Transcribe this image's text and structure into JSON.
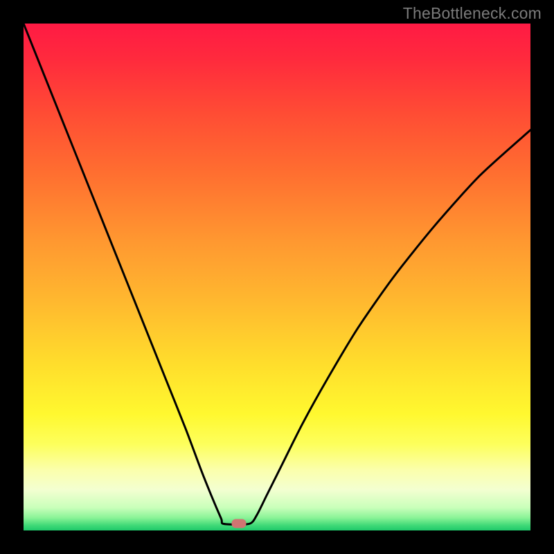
{
  "watermark": "TheBottleneck.com",
  "colors": {
    "frame": "#000000",
    "marker": "#cf7572",
    "curve": "#000000",
    "gradient_stops": [
      {
        "offset": 0.0,
        "color": "#ff1a44"
      },
      {
        "offset": 0.07,
        "color": "#ff2a3d"
      },
      {
        "offset": 0.18,
        "color": "#ff4d34"
      },
      {
        "offset": 0.3,
        "color": "#ff7030"
      },
      {
        "offset": 0.43,
        "color": "#ff9830"
      },
      {
        "offset": 0.55,
        "color": "#ffb92f"
      },
      {
        "offset": 0.67,
        "color": "#ffdd2c"
      },
      {
        "offset": 0.77,
        "color": "#fff82f"
      },
      {
        "offset": 0.83,
        "color": "#fdff5c"
      },
      {
        "offset": 0.88,
        "color": "#fbffab"
      },
      {
        "offset": 0.92,
        "color": "#f3ffd1"
      },
      {
        "offset": 0.955,
        "color": "#c9ffba"
      },
      {
        "offset": 0.975,
        "color": "#8af397"
      },
      {
        "offset": 0.99,
        "color": "#3fd977"
      },
      {
        "offset": 1.0,
        "color": "#1fc96a"
      }
    ]
  },
  "chart_data": {
    "type": "line",
    "title": "",
    "xlabel": "",
    "ylabel": "",
    "x_range": [
      0,
      100
    ],
    "y_range": [
      0,
      100
    ],
    "minimum_at_x": 42,
    "flat_bottom_x": [
      39.5,
      44.5
    ],
    "series": [
      {
        "name": "bottleneck-curve",
        "x": [
          0,
          4,
          8,
          12,
          16,
          20,
          24,
          28,
          32,
          35,
          37,
          39,
          39.5,
          44.5,
          46,
          48,
          51,
          55,
          60,
          66,
          73,
          81,
          90,
          100
        ],
        "y": [
          100,
          90,
          80,
          70,
          60,
          50,
          40,
          30,
          20,
          12,
          7,
          2.3,
          1.3,
          1.3,
          3,
          7,
          13,
          21,
          30,
          40,
          50,
          60,
          70,
          79
        ]
      }
    ],
    "marker": {
      "x": 42.5,
      "y": 1.3
    }
  }
}
